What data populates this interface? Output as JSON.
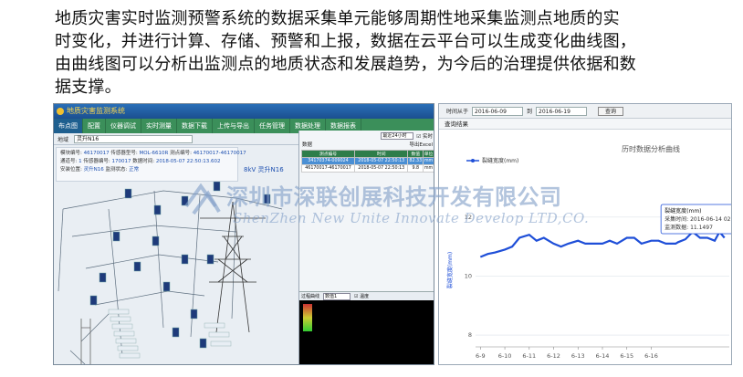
{
  "paragraph": {
    "line1": "地质灾害实时监测预警系统的数据采集单元能够周期性地采集监测点地质的实",
    "line2": "时变化，并进行计算、存储、预警和上报，数据在云平台可以生成变化曲线图，",
    "line3": "由曲线图可以分析出监测点的地质状态和发展趋势，为今后的治理提供依据和数",
    "line4": "据支撑。"
  },
  "left_app": {
    "title": "地质灾害监测系统",
    "tabs": [
      "布点图",
      "配置",
      "仪器调试",
      "实时测量",
      "数据下载",
      "上传与导出",
      "任务管理",
      "数据处理",
      "数据报表"
    ],
    "area_label": "地域",
    "area_value": "灵升N16",
    "info": {
      "module_no_label": "模块编号:",
      "module_no": "46170017",
      "sensor_type_label": "传感器型号:",
      "sensor_type": "MOL-6610R",
      "route_label": "通道号:",
      "route": "1",
      "sensor_no_label": "传感器编号:",
      "sensor_no": "170017",
      "install_label": "安装位置:",
      "install": "灵升N16",
      "point_no_label": "测点编号:",
      "point_no": "46170017-46170017",
      "time_label": "数据时间:",
      "time": "2018-05-07 22:50:13.602",
      "state_label": "监测状态:",
      "state": "正常"
    },
    "map_label": "8kV 灵升N16",
    "right_panel": {
      "range_select": "最近24小时",
      "realtime_label": "实时",
      "data_label": "数据",
      "export_label": "导出Excel",
      "columns": [
        "测点编号",
        "时间",
        "数值",
        "单位"
      ],
      "rows": [
        [
          "34170374-009024",
          "2018-05-07 22:50:13",
          "82.33",
          "mm"
        ],
        [
          "46170017-46170017",
          "2018-05-07 22:50:13",
          "9.8",
          "mm"
        ]
      ],
      "chart_bar_label": "过程曲线",
      "chart_select": "数值1",
      "chart_checkbox": "温度"
    }
  },
  "right_app": {
    "time_from_label": "时间从于",
    "time_from": "2016-06-09",
    "time_to_label": "到",
    "time_to": "2016-06-19",
    "query_button": "查询",
    "result_title": "查询结果",
    "tooltip": {
      "title": "裂缝宽度(mm)",
      "time_label": "采集时间:",
      "time": "2016-06-14 02:55:16",
      "value_label": "监测数据:",
      "value": "11.1497"
    }
  },
  "watermark": {
    "cn": "深圳市深联创展科技开发有限公司",
    "en": "ShenZhen New Unite Innovate Develop LTD,CO."
  },
  "chart_data": {
    "type": "line",
    "title": "历时数据分析曲线",
    "ylabel": "裂缝宽度(mm)",
    "xlabel": "",
    "series": [
      {
        "name": "裂缝宽度(mm)",
        "x": [
          6.0,
          6.3,
          6.6,
          7.0,
          7.3,
          7.6,
          8.0,
          8.3,
          8.6,
          9.0,
          9.3,
          9.6,
          10.0,
          10.3,
          10.6,
          11.0,
          11.3,
          11.6,
          12.0,
          12.3,
          12.6,
          13.0,
          13.3,
          13.6,
          14.0,
          14.1,
          14.4,
          14.7,
          15.0,
          15.3,
          15.6,
          15.8,
          16.0
        ],
        "values": [
          10.65,
          10.75,
          10.8,
          10.9,
          11.0,
          11.3,
          11.4,
          11.2,
          11.3,
          11.1,
          11.0,
          11.1,
          11.2,
          11.1,
          11.1,
          11.1,
          11.2,
          11.1,
          11.3,
          11.3,
          11.1,
          11.2,
          11.2,
          11.1,
          11.1,
          11.15,
          11.25,
          11.5,
          11.3,
          11.3,
          11.2,
          11.5,
          11.3
        ]
      }
    ],
    "xticks": [
      "6-9",
      "6-10",
      "6-11",
      "6-12",
      "6-13",
      "6-14",
      "6-15",
      "6-16"
    ],
    "xlim": [
      5.8,
      16.2
    ],
    "yticks": [
      8,
      10,
      12
    ],
    "ylim": [
      7.6,
      12.8
    ],
    "grid": true,
    "legend": "top-left",
    "colors": {
      "line": "#1f4fd8"
    }
  }
}
